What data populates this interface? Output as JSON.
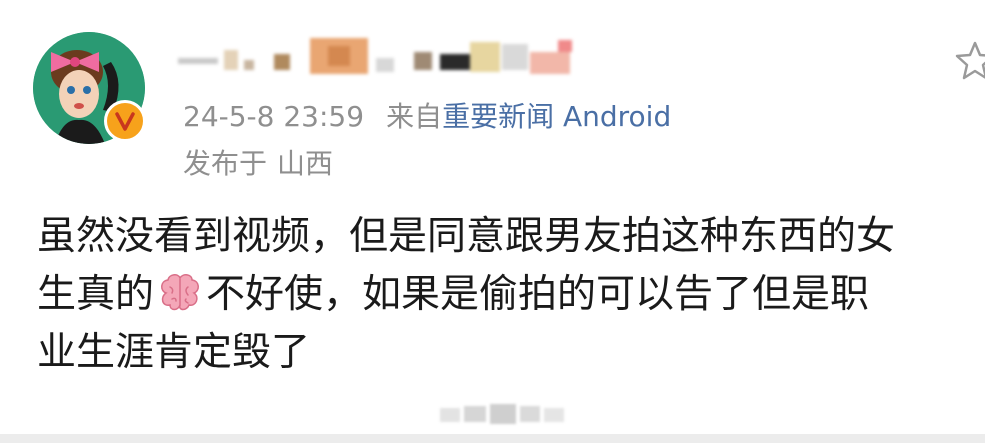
{
  "post": {
    "timestamp": "24-5-8 23:59",
    "from_label": "来自",
    "source_app": "重要新闻 Android",
    "location_label": "发布于",
    "location": "山西",
    "body_lines": [
      "虽然没看到视频，但是同意跟男友拍这种东西的女",
      "生真的",
      "不好使，如果是偷拍的可以告了但是职",
      "业生涯肯定毁了"
    ]
  },
  "colors": {
    "meta_text": "#8f8f8f",
    "source_link": "#4a6fa5",
    "body_text": "#1a1a1a",
    "avatar_bg": "#2a9a73",
    "verified_badge": "#f7a21b"
  },
  "icons": {
    "favorite": "star-outline-icon",
    "verified": "verified-v-badge-icon",
    "emoji": "brain-emoji-icon"
  }
}
